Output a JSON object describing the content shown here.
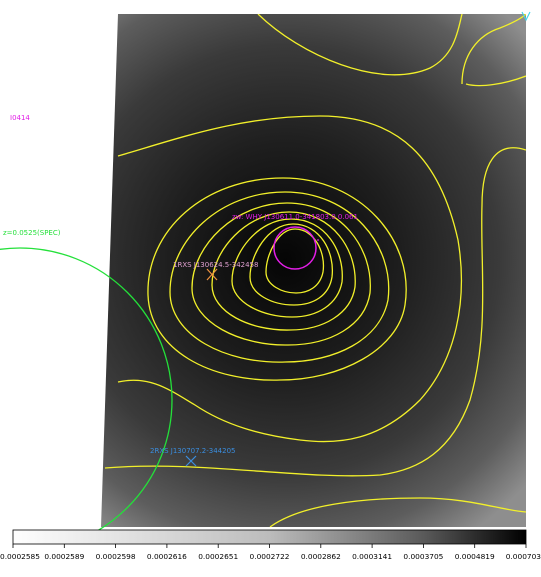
{
  "colors": {
    "contour": "#f2f02a",
    "cluster_circle": "#24e03a",
    "magenta": "#e21ee6",
    "orange_marker": "#f09340",
    "blue_marker": "#3a8ee0",
    "cyan": "#3fd5e8",
    "image_dark": "#080808",
    "image_light": "#8a8a8a"
  },
  "labels": {
    "top_left_tag": "I0414",
    "cluster_label": "z=0.0525(SPEC)",
    "center_source": "zw: WHY J130611.0-341803.0 0.061",
    "rass_source": "1RXS J130624.5-342458",
    "xmm_source": "2RXS J130707.2-344205"
  },
  "colorbar": {
    "ticks": [
      "0.0002585",
      "0.0002589",
      "0.0002598",
      "0.0002616",
      "0.0002651",
      "0.0002722",
      "0.0002862",
      "0.0003141",
      "0.0003705",
      "0.0004819",
      "0.000703"
    ]
  }
}
